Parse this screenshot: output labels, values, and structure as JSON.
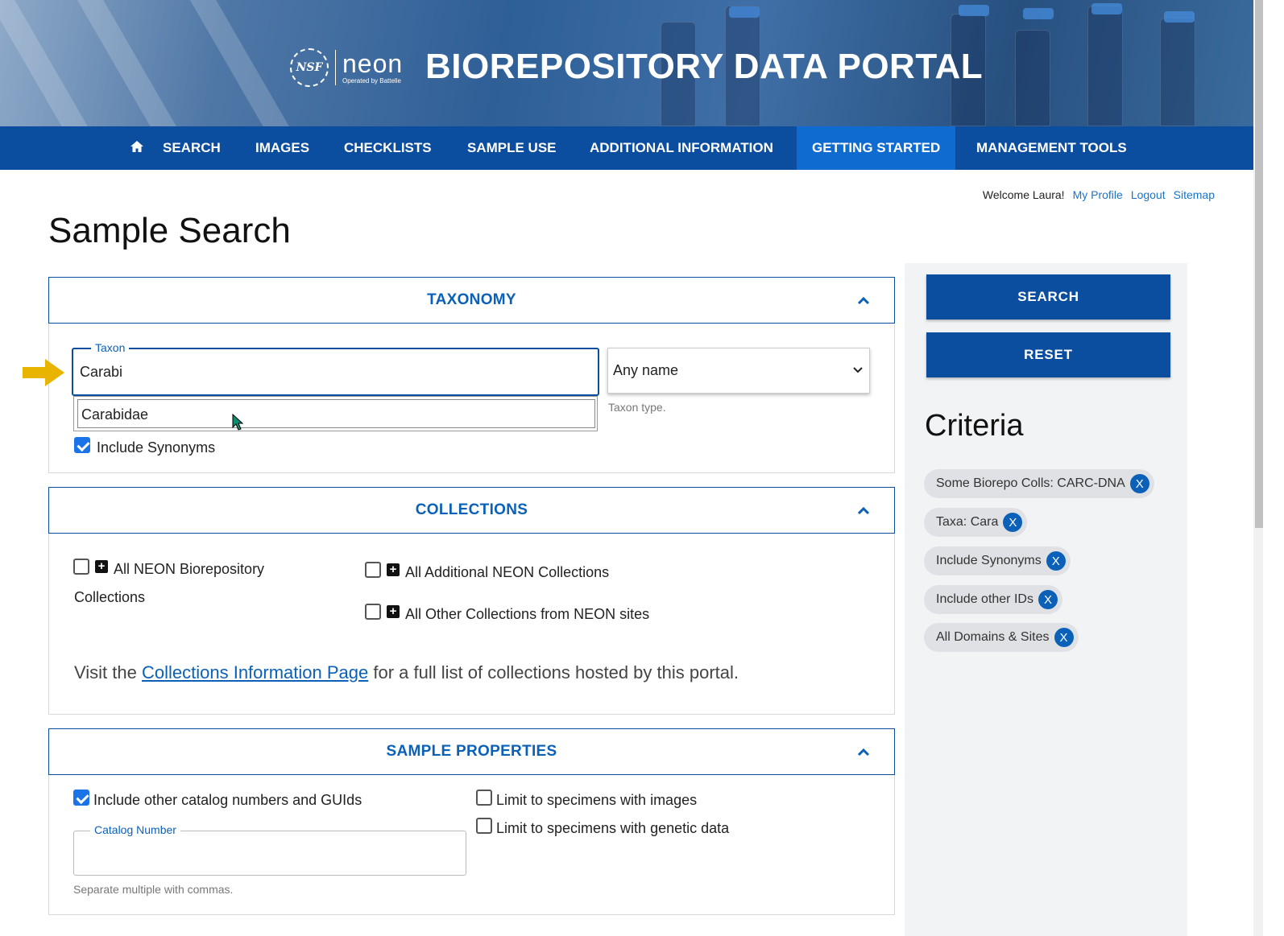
{
  "banner": {
    "nsf_label": "NSF",
    "neon_label": "neon",
    "neon_sub": "Operated by Battelle",
    "title": "BIOREPOSITORY DATA PORTAL"
  },
  "nav": {
    "items": [
      "SEARCH",
      "IMAGES",
      "CHECKLISTS",
      "SAMPLE USE",
      "ADDITIONAL INFORMATION",
      "GETTING STARTED",
      "MANAGEMENT TOOLS"
    ],
    "active": "GETTING STARTED"
  },
  "user": {
    "welcome": "Welcome Laura!",
    "profile": "My Profile",
    "logout": "Logout",
    "sitemap": "Sitemap"
  },
  "page": {
    "title": "Sample Search"
  },
  "taxonomy": {
    "header": "TAXONOMY",
    "taxon_legend": "Taxon",
    "taxon_value": "Carabi",
    "suggestion": "Carabidae",
    "taxon_type_value": "Any name",
    "taxon_type_helper": "Taxon type.",
    "include_synonyms": "Include Synonyms",
    "include_synonyms_checked": true
  },
  "collections": {
    "header": "COLLECTIONS",
    "all_neon_line1": "All NEON Biorepository",
    "all_neon_line2": "Collections",
    "all_additional": "All Additional NEON Collections",
    "all_other": "All Other Collections from NEON sites",
    "info_pre": "Visit the ",
    "info_link": "Collections Information Page",
    "info_post": " for a full list of collections hosted by this portal."
  },
  "sample_properties": {
    "header": "SAMPLE PROPERTIES",
    "include_other": "Include other catalog numbers and GUIds",
    "include_other_checked": true,
    "catalog_legend": "Catalog Number",
    "catalog_helper": "Separate multiple with commas.",
    "limit_images": "Limit to specimens with images",
    "limit_genetic": "Limit to specimens with genetic data"
  },
  "sidebar": {
    "search_label": "SEARCH",
    "reset_label": "RESET",
    "criteria_title": "Criteria",
    "chips": [
      "Some Biorepo Colls: CARC-DNA",
      "Taxa: Cara",
      "Include Synonyms",
      "Include other IDs",
      "All Domains & Sites"
    ],
    "chip_remove": "X"
  },
  "colors": {
    "nav_bg": "#0b4d9f",
    "nav_active": "#0f6bd0",
    "accent": "#0b60b8",
    "arrow": "#e8b400"
  }
}
